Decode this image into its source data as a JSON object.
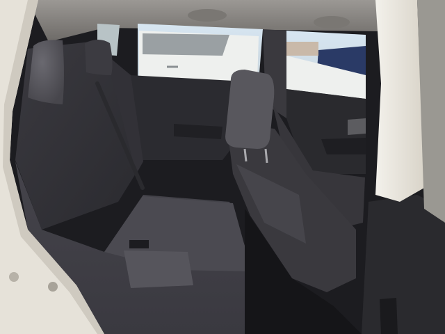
{
  "photo": {
    "subject": "rear-seat-interior",
    "palette": {
      "exterior_white": "#e6e2d9",
      "cabin_shadow": "#1c1c20",
      "headliner": "#8d8a86",
      "seat_fabric": "#3b3a3f",
      "seat_cushion": "#4a4950",
      "headrest": "#55545a",
      "window_sky": "#cfe0ee",
      "outside_car_white": "#eef0ee",
      "parked_car_blue": "#2a3a66",
      "door_panel": "#2a2a2e"
    }
  }
}
